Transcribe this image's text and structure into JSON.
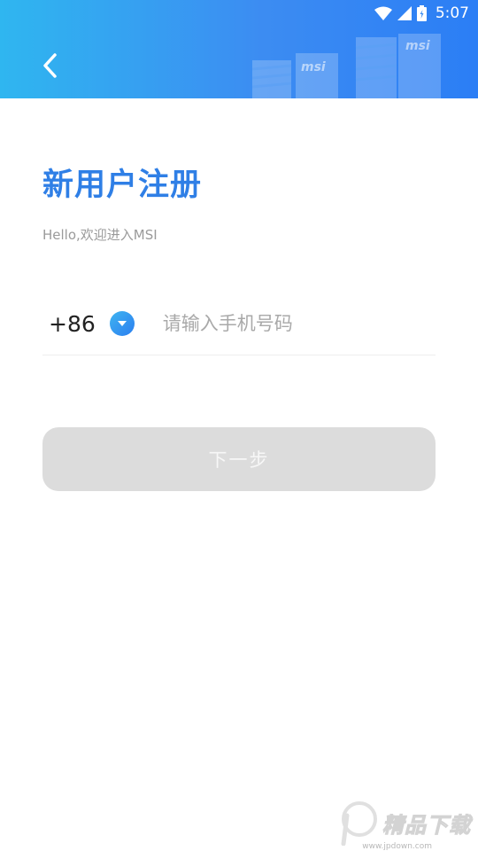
{
  "status_bar": {
    "time": "5:07",
    "icons": [
      "wifi-icon",
      "cell-signal-icon",
      "battery-icon"
    ]
  },
  "header": {
    "back_icon": "chevron-left-icon",
    "brand_logo_text": "msi",
    "gradient": [
      "#2fb6f0",
      "#2b7ef5"
    ]
  },
  "page": {
    "title": "新用户注册",
    "subtitle": "Hello,欢迎进入MSI"
  },
  "phone": {
    "country_code": "+86",
    "dropdown_icon": "caret-down-icon",
    "placeholder": "请输入手机号码",
    "value": ""
  },
  "next_button": {
    "label": "下一步",
    "enabled": false
  },
  "watermark": {
    "text": "精品下载",
    "sub": "www.jpdown.com"
  },
  "colors": {
    "accent": "#2f7fe6",
    "button_disabled_bg": "#dcdcdc",
    "placeholder": "#a9a9a9"
  }
}
